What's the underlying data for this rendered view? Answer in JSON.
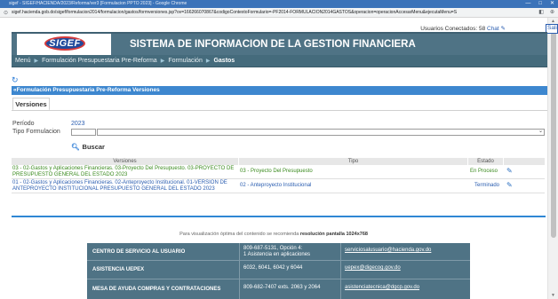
{
  "browser": {
    "title": "sigef - SIGEF/HACIENDA/2023/Reforma/ver3  [Formulacion PPTO 2023] - Google Chrome",
    "url": "sigef.hacienda.gob.do/sigef/formulacion2014/formulacion/gastos/formversiones.jsp?ov=166266070867&codigoContextoFormulario=-PF2014-FORMULACION2014GASTOS&operacion=operacionAccesarMenu&ejecutaMenu=S",
    "minimize": "—",
    "maximize": "□",
    "close": "✕"
  },
  "header": {
    "users_label": "Usuarios Conectados:",
    "users_count": "58",
    "chat_label": "Chat",
    "salir": "Salir",
    "logo_text": "SIGEF",
    "system_title": "SISTEMA DE INFORMACION DE LA GESTION FINANCIERA"
  },
  "menu": {
    "items": [
      "Menú",
      "Formulación Presupuestaria Pre-Reforma",
      "Formulación",
      "Gastos"
    ]
  },
  "section": {
    "title": "«Formulación Presupuestaria Pre-Reforma Versiones"
  },
  "tabs": [
    "Versiones"
  ],
  "form": {
    "periodo_label": "Período",
    "periodo_value": "2023",
    "tipo_label": "Tipo Formulacion",
    "buscar_label": "Buscar"
  },
  "table": {
    "headers": [
      "Versiones",
      "Tipo",
      "Estado"
    ],
    "rows": [
      {
        "version": "03 - 02-Gastos y Aplicaciones Financieras. 03-Proyecto Del Presupuesto. 03-PROYECTO DE PRESUPUESTO GENERAL DEL ESTADO 2023",
        "tipo": "03 - Proyecto Del Presupuesto",
        "estado": "En Proceso",
        "color": "#3a8a1e"
      },
      {
        "version": "01 - 02-Gastos y Aplicaciones Financieras. 02-Anteproyecto Institucional. 01-VERSION DE ANTEPROYECTO INSTITUCIONAL PRESUPUESTO GENERAL DEL ESTADO 2023",
        "tipo": "02 - Anteproyecto Institucional",
        "estado": "Terminado",
        "color": "#2a5db0"
      }
    ]
  },
  "footer": {
    "note_prefix": "Para visualización óptima del contenido se recomienda",
    "note_bold": "resolución pantalla 1024x768"
  },
  "contacts": [
    {
      "name": "CENTRO DE SERVICIO AL USUARIO",
      "phone": "809-687-5131, Opción 4:",
      "phone2": "1 Asistencia en aplicaciones",
      "email": "serviciosalusuario@hacienda.gov.do"
    },
    {
      "name": "ASISTENCIA UEPEX",
      "phone": "6032, 6041, 6042 y 6044",
      "phone2": "",
      "email": "uepex@digecog.gov.do"
    },
    {
      "name": "MESA DE AYUDA COMPRAS Y CONTRATACIONES",
      "phone": "809-682-7407 exts. 2063 y 2064",
      "phone2": "",
      "email": "asistenciatecnica@dgcp.gov.do"
    }
  ],
  "colors": {
    "banner": "#4f7385",
    "section_bar": "#3d87cf",
    "accent_line": "#2f87d4",
    "link": "#2a5db0"
  }
}
